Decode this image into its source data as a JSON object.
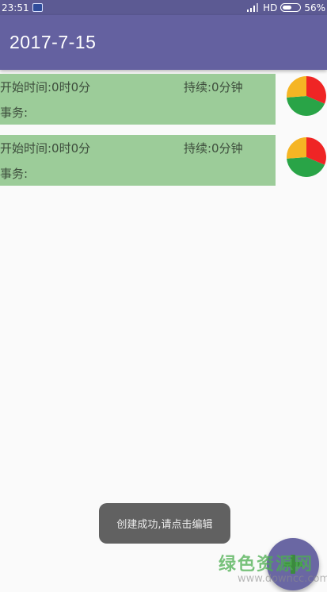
{
  "status_bar": {
    "time": "23:51",
    "network": "HD",
    "battery": "56%"
  },
  "app_bar": {
    "title": "2017-7-15"
  },
  "entries": [
    {
      "start": "开始时间:0时0分",
      "duration": "持续:0分钟",
      "task": "事务:"
    },
    {
      "start": "开始时间:0时0分",
      "duration": "持续:0分钟",
      "task": "事务:"
    }
  ],
  "toast": {
    "message": "创建成功,请点击编辑"
  },
  "watermark": {
    "text": "绿色资源网",
    "url": "www.downcc.com"
  },
  "colors": {
    "app_bar": "#6461a0",
    "entry_background": "#9ccc99",
    "pie_red": "#ef2525",
    "pie_green": "#29a447",
    "pie_yellow": "#f5b524"
  },
  "icons": {
    "fab": "add-icon",
    "pie": "pie-chart-icon"
  }
}
